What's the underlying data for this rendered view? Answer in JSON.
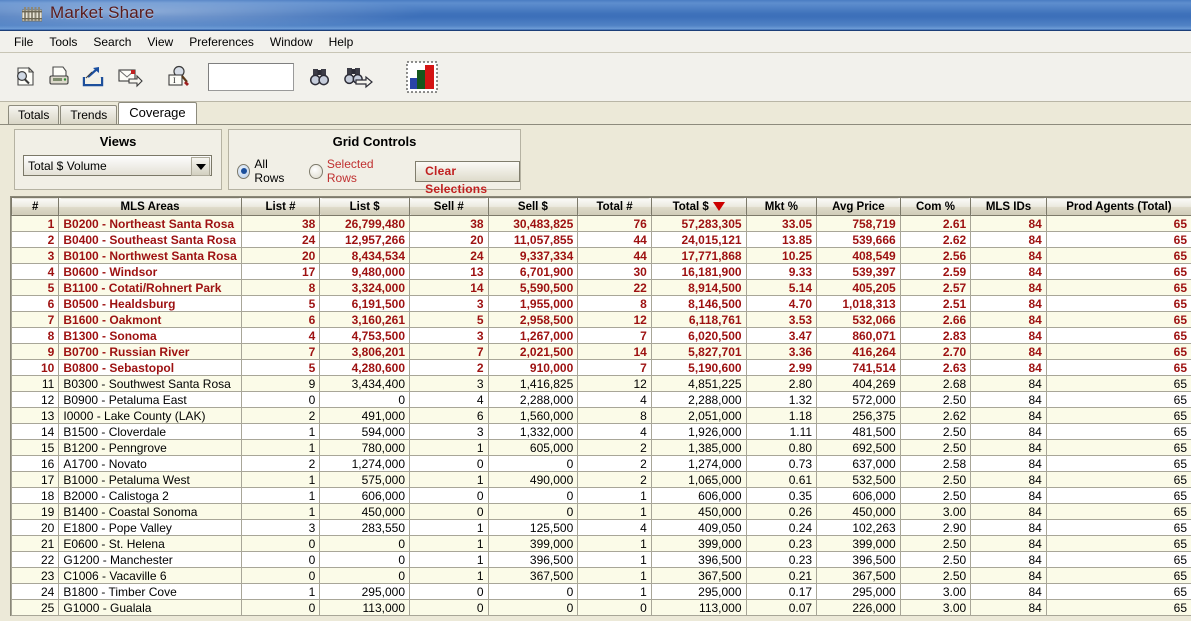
{
  "window": {
    "title": "Market Share",
    "app_icon": "market-share-icon"
  },
  "menubar": {
    "items": [
      "File",
      "Tools",
      "Search",
      "View",
      "Preferences",
      "Window",
      "Help"
    ]
  },
  "toolbar": {
    "buttons": [
      {
        "name": "print-preview-icon",
        "label": "Print Preview"
      },
      {
        "name": "print-icon",
        "label": "Print"
      },
      {
        "name": "export-icon",
        "label": "Export"
      },
      {
        "name": "email-icon",
        "label": "Email"
      },
      {
        "name": "find-record-icon",
        "label": "Find Record"
      }
    ],
    "search_value": "",
    "search_placeholder": "",
    "binoculars_icon": "binoculars-icon",
    "binoculars_next_icon": "binoculars-next-icon",
    "chart_icon": "bar-chart-icon"
  },
  "tabs": [
    {
      "label": "Totals",
      "active": false
    },
    {
      "label": "Trends",
      "active": false
    },
    {
      "label": "Coverage",
      "active": true
    }
  ],
  "views_panel": {
    "title": "Views",
    "selected": "Total $ Volume"
  },
  "grid_controls": {
    "title": "Grid Controls",
    "all_rows_label": "All Rows",
    "selected_rows_label": "Selected Rows",
    "all_rows_selected": true,
    "clear_button": "Clear Selections"
  },
  "grid": {
    "columns": [
      {
        "key": "num",
        "label": "#",
        "align": "right"
      },
      {
        "key": "area",
        "label": "MLS Areas",
        "align": "left"
      },
      {
        "key": "listn",
        "label": "List #",
        "align": "right"
      },
      {
        "key": "listd",
        "label": "List $",
        "align": "right"
      },
      {
        "key": "selln",
        "label": "Sell #",
        "align": "right"
      },
      {
        "key": "selld",
        "label": "Sell $",
        "align": "right"
      },
      {
        "key": "totn",
        "label": "Total #",
        "align": "right"
      },
      {
        "key": "totd",
        "label": "Total $",
        "align": "right",
        "sorted": "desc"
      },
      {
        "key": "mkt",
        "label": "Mkt %",
        "align": "right"
      },
      {
        "key": "avg",
        "label": "Avg Price",
        "align": "right"
      },
      {
        "key": "com",
        "label": "Com %",
        "align": "right"
      },
      {
        "key": "mlsids",
        "label": "MLS IDs",
        "align": "right"
      },
      {
        "key": "agents",
        "label": "Prod Agents (Total)",
        "align": "right"
      }
    ],
    "highlight_rows": 10,
    "rows": [
      [
        "1",
        "B0200 - Northeast Santa Rosa",
        "38",
        "26,799,480",
        "38",
        "30,483,825",
        "76",
        "57,283,305",
        "33.05",
        "758,719",
        "2.61",
        "84",
        "65"
      ],
      [
        "2",
        "B0400 - Southeast Santa Rosa",
        "24",
        "12,957,266",
        "20",
        "11,057,855",
        "44",
        "24,015,121",
        "13.85",
        "539,666",
        "2.62",
        "84",
        "65"
      ],
      [
        "3",
        "B0100 - Northwest Santa Rosa",
        "20",
        "8,434,534",
        "24",
        "9,337,334",
        "44",
        "17,771,868",
        "10.25",
        "408,549",
        "2.56",
        "84",
        "65"
      ],
      [
        "4",
        "B0600 - Windsor",
        "17",
        "9,480,000",
        "13",
        "6,701,900",
        "30",
        "16,181,900",
        "9.33",
        "539,397",
        "2.59",
        "84",
        "65"
      ],
      [
        "5",
        "B1100 - Cotati/Rohnert Park",
        "8",
        "3,324,000",
        "14",
        "5,590,500",
        "22",
        "8,914,500",
        "5.14",
        "405,205",
        "2.57",
        "84",
        "65"
      ],
      [
        "6",
        "B0500 - Healdsburg",
        "5",
        "6,191,500",
        "3",
        "1,955,000",
        "8",
        "8,146,500",
        "4.70",
        "1,018,313",
        "2.51",
        "84",
        "65"
      ],
      [
        "7",
        "B1600 - Oakmont",
        "6",
        "3,160,261",
        "5",
        "2,958,500",
        "12",
        "6,118,761",
        "3.53",
        "532,066",
        "2.66",
        "84",
        "65"
      ],
      [
        "8",
        "B1300 - Sonoma",
        "4",
        "4,753,500",
        "3",
        "1,267,000",
        "7",
        "6,020,500",
        "3.47",
        "860,071",
        "2.83",
        "84",
        "65"
      ],
      [
        "9",
        "B0700 - Russian River",
        "7",
        "3,806,201",
        "7",
        "2,021,500",
        "14",
        "5,827,701",
        "3.36",
        "416,264",
        "2.70",
        "84",
        "65"
      ],
      [
        "10",
        "B0800 - Sebastopol",
        "5",
        "4,280,600",
        "2",
        "910,000",
        "7",
        "5,190,600",
        "2.99",
        "741,514",
        "2.63",
        "84",
        "65"
      ],
      [
        "11",
        "B0300 - Southwest Santa Rosa",
        "9",
        "3,434,400",
        "3",
        "1,416,825",
        "12",
        "4,851,225",
        "2.80",
        "404,269",
        "2.68",
        "84",
        "65"
      ],
      [
        "12",
        "B0900 - Petaluma East",
        "0",
        "0",
        "4",
        "2,288,000",
        "4",
        "2,288,000",
        "1.32",
        "572,000",
        "2.50",
        "84",
        "65"
      ],
      [
        "13",
        "I0000 - Lake County (LAK)",
        "2",
        "491,000",
        "6",
        "1,560,000",
        "8",
        "2,051,000",
        "1.18",
        "256,375",
        "2.62",
        "84",
        "65"
      ],
      [
        "14",
        "B1500 - Cloverdale",
        "1",
        "594,000",
        "3",
        "1,332,000",
        "4",
        "1,926,000",
        "1.11",
        "481,500",
        "2.50",
        "84",
        "65"
      ],
      [
        "15",
        "B1200 - Penngrove",
        "1",
        "780,000",
        "1",
        "605,000",
        "2",
        "1,385,000",
        "0.80",
        "692,500",
        "2.50",
        "84",
        "65"
      ],
      [
        "16",
        "A1700 - Novato",
        "2",
        "1,274,000",
        "0",
        "0",
        "2",
        "1,274,000",
        "0.73",
        "637,000",
        "2.58",
        "84",
        "65"
      ],
      [
        "17",
        "B1000 - Petaluma West",
        "1",
        "575,000",
        "1",
        "490,000",
        "2",
        "1,065,000",
        "0.61",
        "532,500",
        "2.50",
        "84",
        "65"
      ],
      [
        "18",
        "B2000 - Calistoga 2",
        "1",
        "606,000",
        "0",
        "0",
        "1",
        "606,000",
        "0.35",
        "606,000",
        "2.50",
        "84",
        "65"
      ],
      [
        "19",
        "B1400 - Coastal Sonoma",
        "1",
        "450,000",
        "0",
        "0",
        "1",
        "450,000",
        "0.26",
        "450,000",
        "3.00",
        "84",
        "65"
      ],
      [
        "20",
        "E1800 - Pope Valley",
        "3",
        "283,550",
        "1",
        "125,500",
        "4",
        "409,050",
        "0.24",
        "102,263",
        "2.90",
        "84",
        "65"
      ],
      [
        "21",
        "E0600 - St. Helena",
        "0",
        "0",
        "1",
        "399,000",
        "1",
        "399,000",
        "0.23",
        "399,000",
        "2.50",
        "84",
        "65"
      ],
      [
        "22",
        "G1200 - Manchester",
        "0",
        "0",
        "1",
        "396,500",
        "1",
        "396,500",
        "0.23",
        "396,500",
        "2.50",
        "84",
        "65"
      ],
      [
        "23",
        "C1006 - Vacaville 6",
        "0",
        "0",
        "1",
        "367,500",
        "1",
        "367,500",
        "0.21",
        "367,500",
        "2.50",
        "84",
        "65"
      ],
      [
        "24",
        "B1800 - Timber Cove",
        "1",
        "295,000",
        "0",
        "0",
        "1",
        "295,000",
        "0.17",
        "295,000",
        "3.00",
        "84",
        "65"
      ],
      [
        "25",
        "G1000 - Gualala",
        "0",
        "113,000",
        "0",
        "0",
        "0",
        "113,000",
        "0.07",
        "226,000",
        "3.00",
        "84",
        "65"
      ]
    ]
  },
  "colors": {
    "highlight_text": "#9d1111",
    "alt_row": "#fbfbe8",
    "title_bar": "#3f72bb",
    "accent_red": "#cc0000"
  }
}
